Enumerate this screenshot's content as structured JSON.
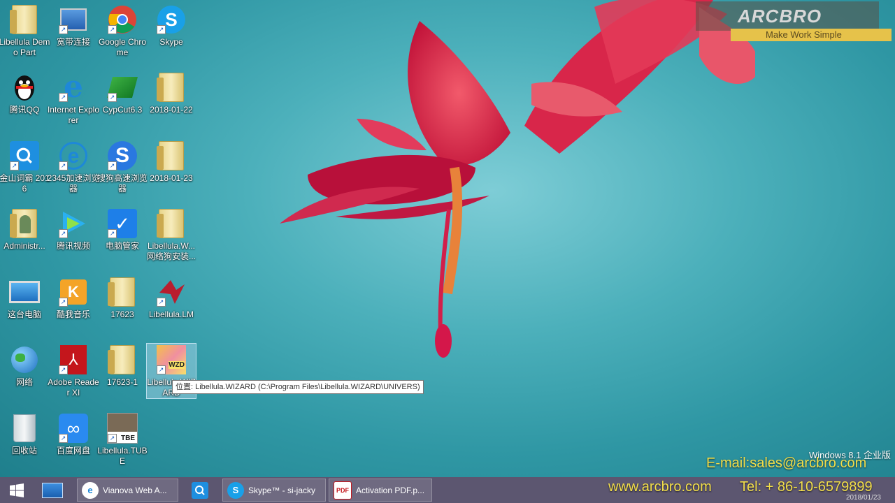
{
  "desktop_icons": [
    {
      "label": "Libellula Demo Part",
      "icon": "folder-icon"
    },
    {
      "label": "宽带连接",
      "icon": "network-connection-icon"
    },
    {
      "label": "Google Chrome",
      "icon": "chrome-icon"
    },
    {
      "label": "Skype",
      "icon": "skype-icon"
    },
    {
      "label": "腾讯QQ",
      "icon": "qq-penguin-icon"
    },
    {
      "label": "Internet Explorer",
      "icon": "internet-explorer-icon"
    },
    {
      "label": "CypCut6.3",
      "icon": "cypcut-icon"
    },
    {
      "label": "2018-01-22",
      "icon": "folder-icon"
    },
    {
      "label": "金山词霸 2016",
      "icon": "kingsoft-dictionary-icon"
    },
    {
      "label": "2345加速浏览器",
      "icon": "browser-2345-icon"
    },
    {
      "label": "搜狗高速浏览器",
      "icon": "sogou-browser-icon"
    },
    {
      "label": "2018-01-23",
      "icon": "folder-icon"
    },
    {
      "label": "Administr...",
      "icon": "user-folder-icon"
    },
    {
      "label": "腾讯视频",
      "icon": "tencent-video-icon"
    },
    {
      "label": "电脑管家",
      "icon": "pc-manager-shield-icon"
    },
    {
      "label": "Libellula.W... 网络狗安装...",
      "icon": "folder-icon"
    },
    {
      "label": "这台电脑",
      "icon": "this-pc-icon"
    },
    {
      "label": "酷我音乐",
      "icon": "kuwo-music-icon"
    },
    {
      "label": "17623",
      "icon": "folder-icon"
    },
    {
      "label": "Libellula.LM",
      "icon": "libellula-lm-icon"
    },
    {
      "label": "网络",
      "icon": "network-globe-icon"
    },
    {
      "label": "Adobe Reader XI",
      "icon": "adobe-reader-icon"
    },
    {
      "label": "17623-1",
      "icon": "folder-icon"
    },
    {
      "label": "Libellula.WIZARD",
      "icon": "libellula-wizard-icon"
    },
    {
      "label": "回收站",
      "icon": "recycle-bin-icon"
    },
    {
      "label": "百度网盘",
      "icon": "baidu-netdisk-icon"
    },
    {
      "label": "Libellula.TUBE",
      "icon": "libellula-tube-icon"
    }
  ],
  "tooltip": "位置: Libellula.WIZARD (C:\\Program Files\\Libellula.WIZARD\\UNIVERS)",
  "brand": {
    "logo": "ARCBRO",
    "tagline": "Make Work Simple"
  },
  "windows_version": "Windows 8.1 企业版",
  "contact": {
    "email": "E-mail:sales@arcbro.com",
    "web": "www.arcbro.com",
    "tel": "Tel: + 86-10-6579899"
  },
  "taskbar": {
    "items": [
      {
        "label": "",
        "icon": "windows-start-icon"
      },
      {
        "label": "",
        "icon": "desktop-icon"
      },
      {
        "label": "Vianova Web A...",
        "icon": "ie-icon"
      },
      {
        "label": "",
        "icon": "kingsoft-dictionary-icon"
      },
      {
        "label": "Skype™ - si-jacky",
        "icon": "skype-icon"
      },
      {
        "label": "Activation PDF.p...",
        "icon": "pdf-icon"
      }
    ],
    "date": "2018/01/23"
  },
  "colors": {
    "accent": "#e6c24a",
    "taskbar": "#5c5670",
    "contact_text": "#f2de4a"
  }
}
